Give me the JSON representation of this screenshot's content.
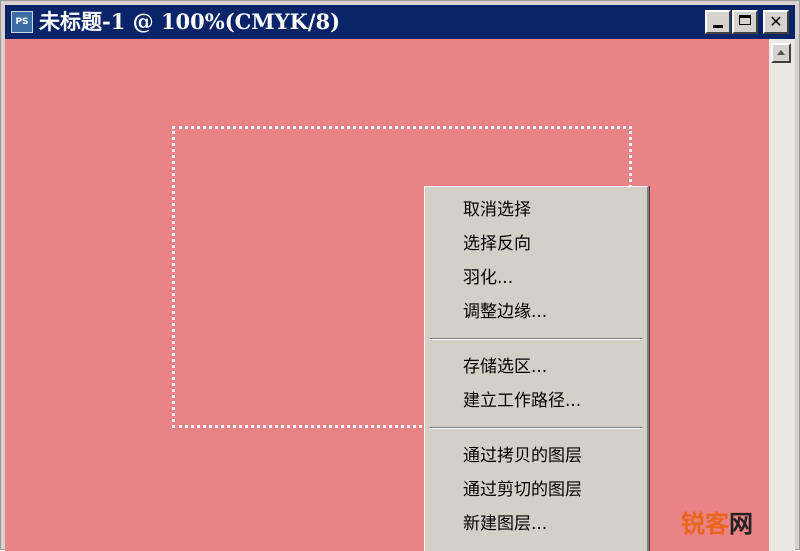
{
  "window": {
    "icon_text": "PS",
    "title": "未标题-1 @ 100%(CMYK/8)"
  },
  "context_menu": {
    "group1": [
      "取消选择",
      "选择反向",
      "羽化...",
      "调整边缘..."
    ],
    "group2": [
      "存储选区...",
      "建立工作路径..."
    ],
    "group3": [
      "通过拷贝的图层",
      "通过剪切的图层",
      "新建图层..."
    ]
  },
  "watermark": {
    "part1": "锐客",
    "part2": "网"
  },
  "colors": {
    "titlebar": "#0a246a",
    "canvas": "#ea8385",
    "menu": "#d4d0c8"
  }
}
